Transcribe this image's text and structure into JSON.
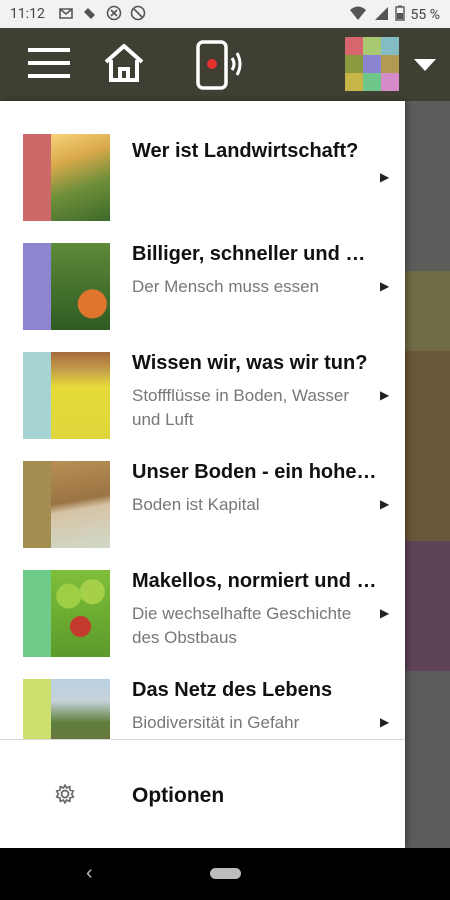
{
  "status_bar": {
    "time": "11:12",
    "battery": "55 %",
    "left_icons": [
      "gmail-icon",
      "notification-icon",
      "blocked-icon",
      "data-saver-icon"
    ],
    "right_icons": [
      "wifi-icon",
      "signal-icon",
      "battery-icon"
    ]
  },
  "app_bar": {
    "icons": [
      "menu-icon",
      "home-icon",
      "device-signal-icon",
      "profile-avatar",
      "dropdown-arrow-icon"
    ],
    "avatar_colors": [
      "#d6656d",
      "#a8c96f",
      "#83bcc2",
      "#8a9a3e",
      "#8c84d0",
      "#b39a53",
      "#c8b547",
      "#6fc68a",
      "#d58cc9"
    ]
  },
  "drawer": {
    "items": [
      {
        "title": "Wer ist Landwirtschaft?",
        "subtitle": "",
        "accent": "#cc6a6a"
      },
      {
        "title": "Billiger, schneller und mehr",
        "subtitle": "Der Mensch muss essen",
        "accent": "#8d85cf"
      },
      {
        "title": "Wissen wir, was wir tun?",
        "subtitle": "Stoffflüsse in Boden, Wasser und Luft",
        "accent": "#a8d3d3"
      },
      {
        "title": "Unser Boden - ein hohes Gut",
        "subtitle": "Boden ist Kapital",
        "accent": "#a48d50"
      },
      {
        "title": "Makellos, normiert und billig",
        "subtitle": "Die wechselhafte Geschichte des Obstbaus",
        "accent": "#6fcb8a"
      },
      {
        "title": "Das Netz des Lebens",
        "subtitle": "Biodiversität in Gefahr",
        "accent": "#cde06f"
      }
    ],
    "options_label": "Optionen"
  },
  "nav_bar": {
    "back_icon": "back-icon",
    "home_pill": "home-pill"
  }
}
